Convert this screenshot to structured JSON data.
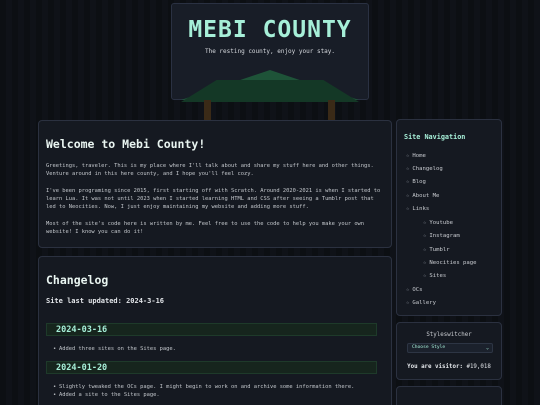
{
  "header": {
    "title": "MEBI COUNTY",
    "subtitle": "The resting county, enjoy your stay."
  },
  "welcome": {
    "title": "Welcome to Mebi County!",
    "p1": "Greetings, traveler. This is my place where I'll talk about and share my stuff here and other things. Venture around in this here county, and I hope you'll feel cozy.",
    "p2": "I've been programing since 2015, first starting off with Scratch. Around 2020-2021 is when I started to learn Lua. It was not until 2023 when I started learning HTML and CSS after seeing a Tumblr post that led to Neocities. Now, I just enjoy maintaining my website and adding more stuff.",
    "p3": "Most of the site's code here is written by me. Feel free to use the code to help you make your own website! I know you can do it!"
  },
  "changelog": {
    "title": "Changelog",
    "updated": "Site last updated: 2024-3-16",
    "entries": [
      {
        "date": "2024-03-16",
        "items": [
          "Added three sites on the Sites page."
        ]
      },
      {
        "date": "2024-01-20",
        "items": [
          "Slightly tweaked the OCs page. I might begin to work on and archive some information there.",
          "Added a site to the Sites page."
        ]
      }
    ]
  },
  "nav": {
    "title": "Site Navigation",
    "items": [
      "Home",
      "Changelog",
      "Blog",
      "About Me",
      "Links",
      "Youtube",
      "Instagram",
      "Tumblr",
      "Neocities page",
      "Sites",
      "OCs",
      "Gallery"
    ],
    "star_icon": "star-icon"
  },
  "styleswitcher": {
    "title": "Styleswitcher",
    "selected": "Choose Style",
    "visitor_label": "You are visitor:",
    "visitor_count": "#19,018"
  },
  "colors": {
    "accent": "#a6efd8",
    "panel": "#151921",
    "background": "#0d1014"
  }
}
